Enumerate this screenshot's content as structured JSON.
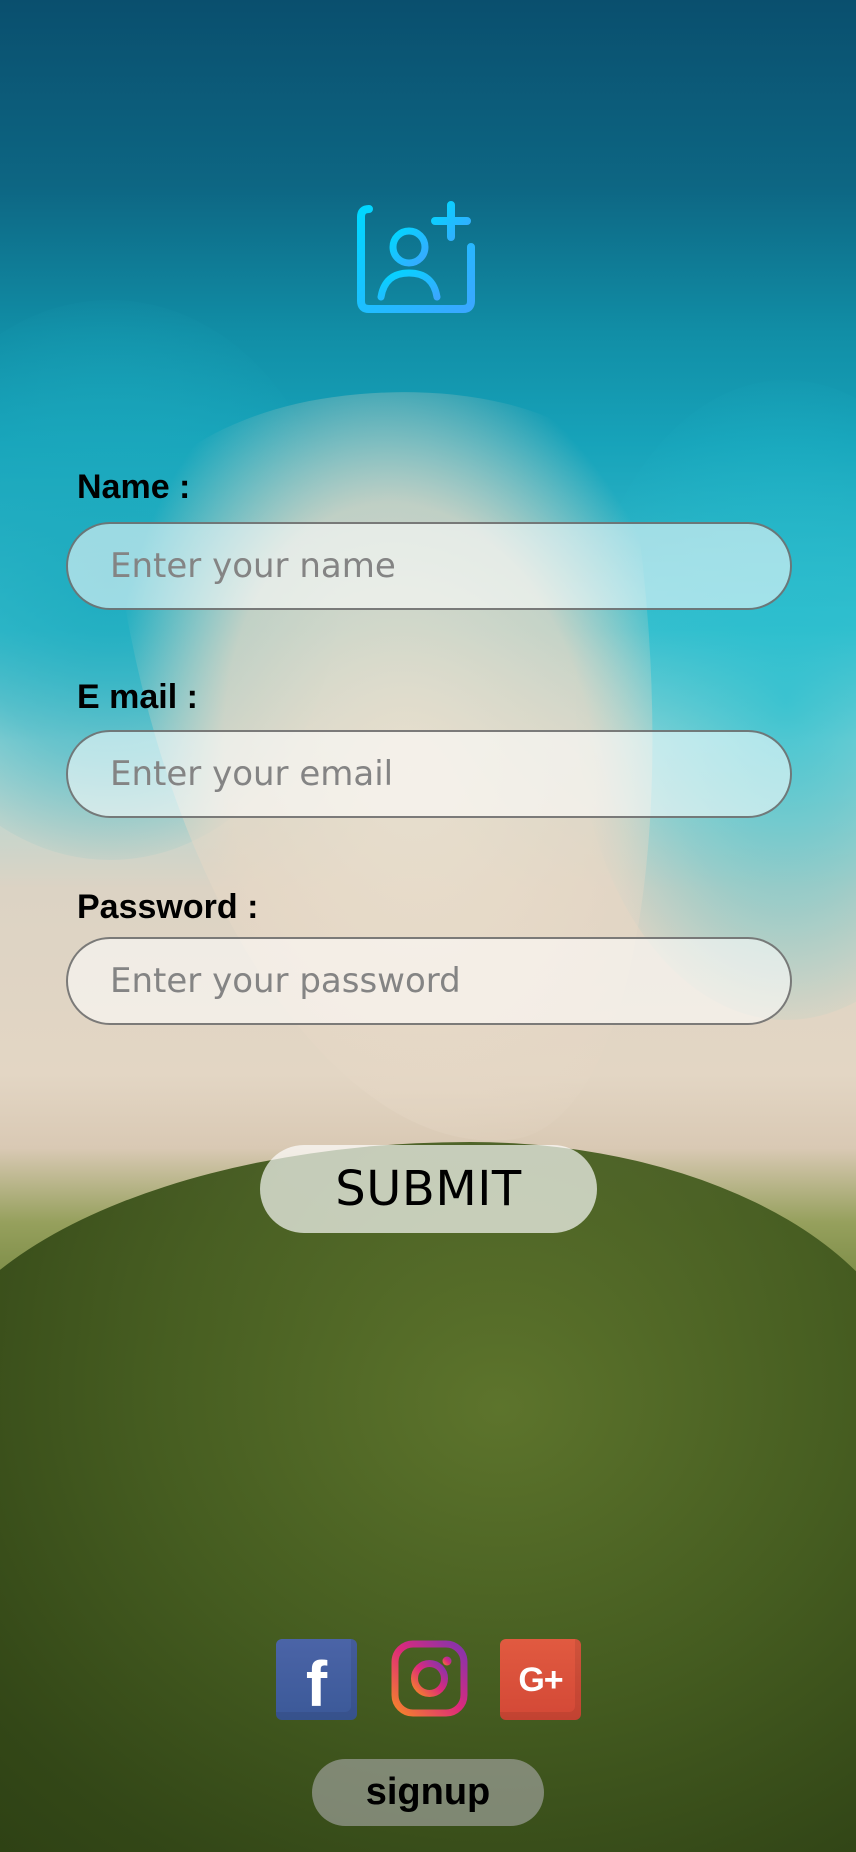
{
  "header": {
    "avatar_icon": "add-user-icon"
  },
  "form": {
    "name_label": "Name :",
    "name_placeholder": "Enter your name",
    "email_label": "E mail :",
    "email_placeholder": "Enter your email",
    "password_label": "Password :",
    "password_placeholder": "Enter your password",
    "submit_label": "SUBMIT"
  },
  "social": {
    "facebook_icon": "facebook-icon",
    "instagram_icon": "instagram-icon",
    "google_plus_icon": "google-plus-icon",
    "google_plus_text": "G+"
  },
  "footer": {
    "signup_label": "signup"
  },
  "colors": {
    "avatar_gradient_start": "#00d7ff",
    "avatar_gradient_end": "#3aa7ff",
    "facebook": "#3b5998",
    "google_plus": "#dd4b39",
    "instagram_orange": "#f58529",
    "instagram_pink": "#dd2a7b",
    "instagram_purple": "#8134af"
  }
}
